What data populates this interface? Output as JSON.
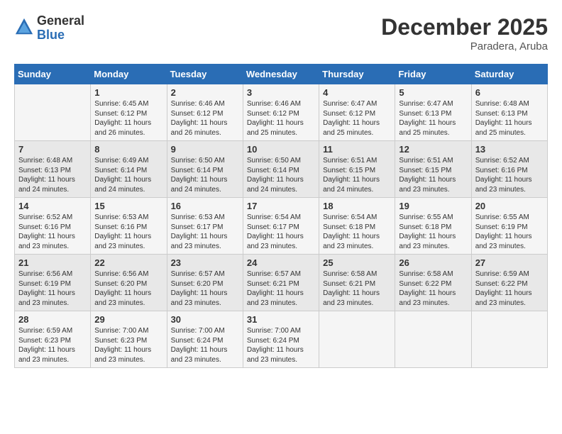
{
  "logo": {
    "general": "General",
    "blue": "Blue"
  },
  "title": "December 2025",
  "location": "Paradera, Aruba",
  "days_of_week": [
    "Sunday",
    "Monday",
    "Tuesday",
    "Wednesday",
    "Thursday",
    "Friday",
    "Saturday"
  ],
  "weeks": [
    [
      {
        "day": "",
        "info": ""
      },
      {
        "day": "1",
        "info": "Sunrise: 6:45 AM\nSunset: 6:12 PM\nDaylight: 11 hours and 26 minutes."
      },
      {
        "day": "2",
        "info": "Sunrise: 6:46 AM\nSunset: 6:12 PM\nDaylight: 11 hours and 26 minutes."
      },
      {
        "day": "3",
        "info": "Sunrise: 6:46 AM\nSunset: 6:12 PM\nDaylight: 11 hours and 25 minutes."
      },
      {
        "day": "4",
        "info": "Sunrise: 6:47 AM\nSunset: 6:12 PM\nDaylight: 11 hours and 25 minutes."
      },
      {
        "day": "5",
        "info": "Sunrise: 6:47 AM\nSunset: 6:13 PM\nDaylight: 11 hours and 25 minutes."
      },
      {
        "day": "6",
        "info": "Sunrise: 6:48 AM\nSunset: 6:13 PM\nDaylight: 11 hours and 25 minutes."
      }
    ],
    [
      {
        "day": "7",
        "info": "Sunrise: 6:48 AM\nSunset: 6:13 PM\nDaylight: 11 hours and 24 minutes."
      },
      {
        "day": "8",
        "info": "Sunrise: 6:49 AM\nSunset: 6:14 PM\nDaylight: 11 hours and 24 minutes."
      },
      {
        "day": "9",
        "info": "Sunrise: 6:50 AM\nSunset: 6:14 PM\nDaylight: 11 hours and 24 minutes."
      },
      {
        "day": "10",
        "info": "Sunrise: 6:50 AM\nSunset: 6:14 PM\nDaylight: 11 hours and 24 minutes."
      },
      {
        "day": "11",
        "info": "Sunrise: 6:51 AM\nSunset: 6:15 PM\nDaylight: 11 hours and 24 minutes."
      },
      {
        "day": "12",
        "info": "Sunrise: 6:51 AM\nSunset: 6:15 PM\nDaylight: 11 hours and 23 minutes."
      },
      {
        "day": "13",
        "info": "Sunrise: 6:52 AM\nSunset: 6:16 PM\nDaylight: 11 hours and 23 minutes."
      }
    ],
    [
      {
        "day": "14",
        "info": "Sunrise: 6:52 AM\nSunset: 6:16 PM\nDaylight: 11 hours and 23 minutes."
      },
      {
        "day": "15",
        "info": "Sunrise: 6:53 AM\nSunset: 6:16 PM\nDaylight: 11 hours and 23 minutes."
      },
      {
        "day": "16",
        "info": "Sunrise: 6:53 AM\nSunset: 6:17 PM\nDaylight: 11 hours and 23 minutes."
      },
      {
        "day": "17",
        "info": "Sunrise: 6:54 AM\nSunset: 6:17 PM\nDaylight: 11 hours and 23 minutes."
      },
      {
        "day": "18",
        "info": "Sunrise: 6:54 AM\nSunset: 6:18 PM\nDaylight: 11 hours and 23 minutes."
      },
      {
        "day": "19",
        "info": "Sunrise: 6:55 AM\nSunset: 6:18 PM\nDaylight: 11 hours and 23 minutes."
      },
      {
        "day": "20",
        "info": "Sunrise: 6:55 AM\nSunset: 6:19 PM\nDaylight: 11 hours and 23 minutes."
      }
    ],
    [
      {
        "day": "21",
        "info": "Sunrise: 6:56 AM\nSunset: 6:19 PM\nDaylight: 11 hours and 23 minutes."
      },
      {
        "day": "22",
        "info": "Sunrise: 6:56 AM\nSunset: 6:20 PM\nDaylight: 11 hours and 23 minutes."
      },
      {
        "day": "23",
        "info": "Sunrise: 6:57 AM\nSunset: 6:20 PM\nDaylight: 11 hours and 23 minutes."
      },
      {
        "day": "24",
        "info": "Sunrise: 6:57 AM\nSunset: 6:21 PM\nDaylight: 11 hours and 23 minutes."
      },
      {
        "day": "25",
        "info": "Sunrise: 6:58 AM\nSunset: 6:21 PM\nDaylight: 11 hours and 23 minutes."
      },
      {
        "day": "26",
        "info": "Sunrise: 6:58 AM\nSunset: 6:22 PM\nDaylight: 11 hours and 23 minutes."
      },
      {
        "day": "27",
        "info": "Sunrise: 6:59 AM\nSunset: 6:22 PM\nDaylight: 11 hours and 23 minutes."
      }
    ],
    [
      {
        "day": "28",
        "info": "Sunrise: 6:59 AM\nSunset: 6:23 PM\nDaylight: 11 hours and 23 minutes."
      },
      {
        "day": "29",
        "info": "Sunrise: 7:00 AM\nSunset: 6:23 PM\nDaylight: 11 hours and 23 minutes."
      },
      {
        "day": "30",
        "info": "Sunrise: 7:00 AM\nSunset: 6:24 PM\nDaylight: 11 hours and 23 minutes."
      },
      {
        "day": "31",
        "info": "Sunrise: 7:00 AM\nSunset: 6:24 PM\nDaylight: 11 hours and 23 minutes."
      },
      {
        "day": "",
        "info": ""
      },
      {
        "day": "",
        "info": ""
      },
      {
        "day": "",
        "info": ""
      }
    ]
  ]
}
